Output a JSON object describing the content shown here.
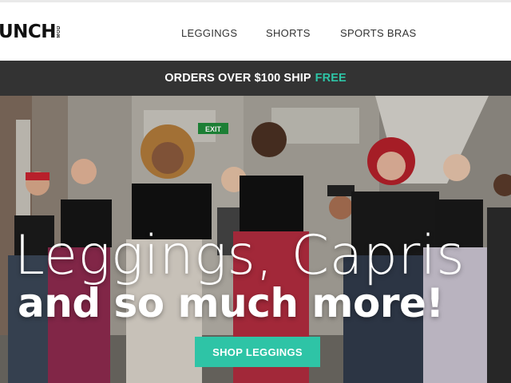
{
  "header": {
    "logo_text": "UNCH",
    "logo_sub": "MOD"
  },
  "nav": {
    "items": [
      {
        "label": "LEGGINGS"
      },
      {
        "label": "SHORTS"
      },
      {
        "label": "SPORTS BRAS"
      }
    ]
  },
  "promo": {
    "text": "ORDERS OVER $100 SHIP",
    "accent": "FREE"
  },
  "hero": {
    "headline_line1": "Leggings, Capris",
    "headline_line2": "and so much more!",
    "cta_label": "SHOP LEGGINGS",
    "exit_sign": "EXIT"
  },
  "colors": {
    "accent": "#2ec4a6",
    "promo_bg": "#333333"
  }
}
